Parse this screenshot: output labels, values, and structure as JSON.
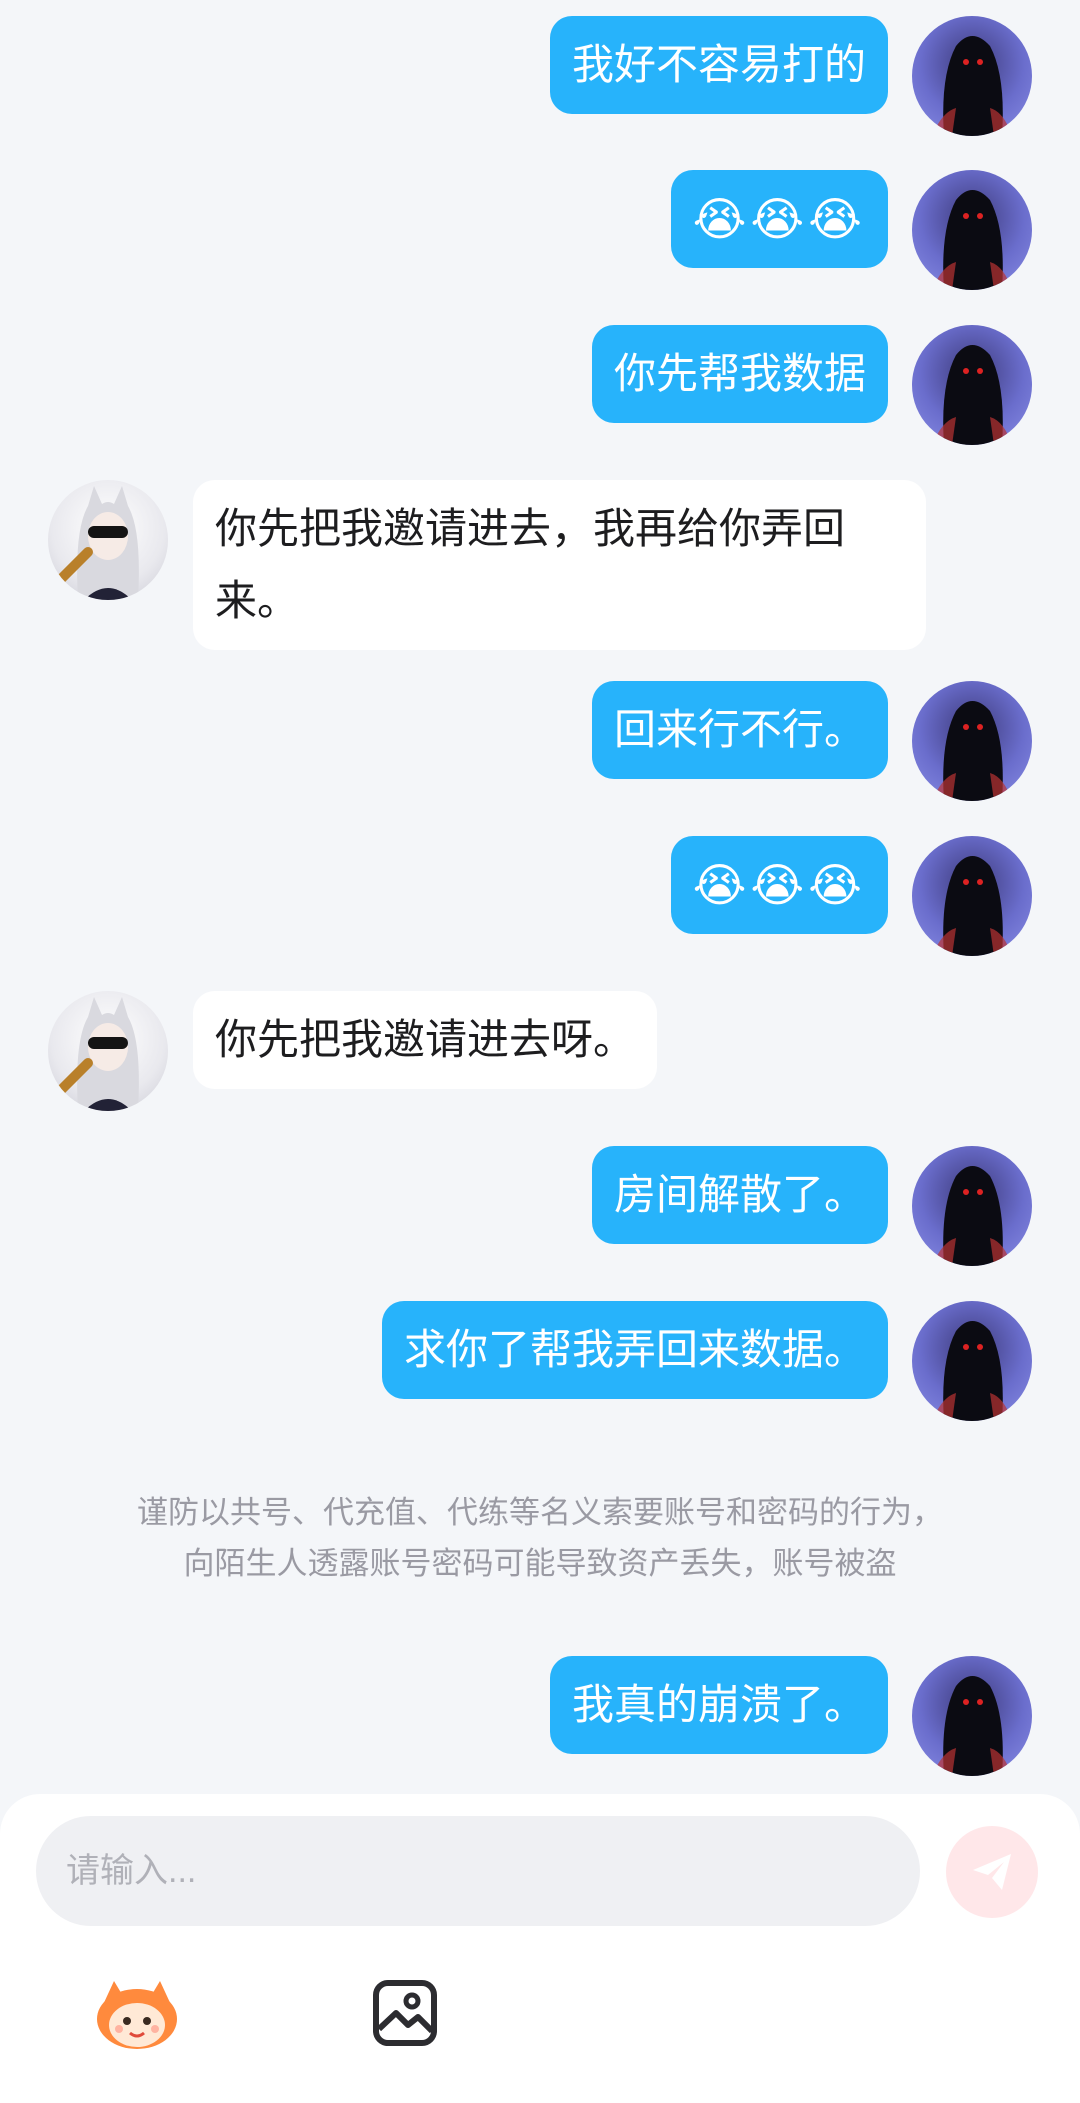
{
  "messages": [
    {
      "from": "me",
      "text": "我好不容易打的"
    },
    {
      "from": "me",
      "text": "😭😭😭"
    },
    {
      "from": "me",
      "text": "你先帮我数据"
    },
    {
      "from": "other",
      "text": "你先把我邀请进去，我再给你弄回\n来。"
    },
    {
      "from": "me",
      "text": "回来行不行。"
    },
    {
      "from": "me",
      "text": "😭😭😭"
    },
    {
      "from": "other",
      "text": "你先把我邀请进去呀。"
    },
    {
      "from": "me",
      "text": "房间解散了。"
    },
    {
      "from": "me",
      "text": "求你了帮我弄回来数据。"
    },
    {
      "from": "me",
      "text": "我真的崩溃了。"
    }
  ],
  "notice": {
    "line1": "谨防以共号、代充值、代练等名义索要账号和密码的行为，",
    "line2": "向陌生人透露账号密码可能导致资产丢失，账号被盗"
  },
  "composer": {
    "placeholder": "请输入...",
    "send_icon": "send-icon",
    "tools": [
      "emoji-sticker-icon",
      "image-icon"
    ]
  },
  "colors": {
    "my_bubble": "#27b3fb",
    "other_bubble": "#ffffff",
    "background": "#f4f6f9",
    "send_button": "#ffe7e9"
  }
}
